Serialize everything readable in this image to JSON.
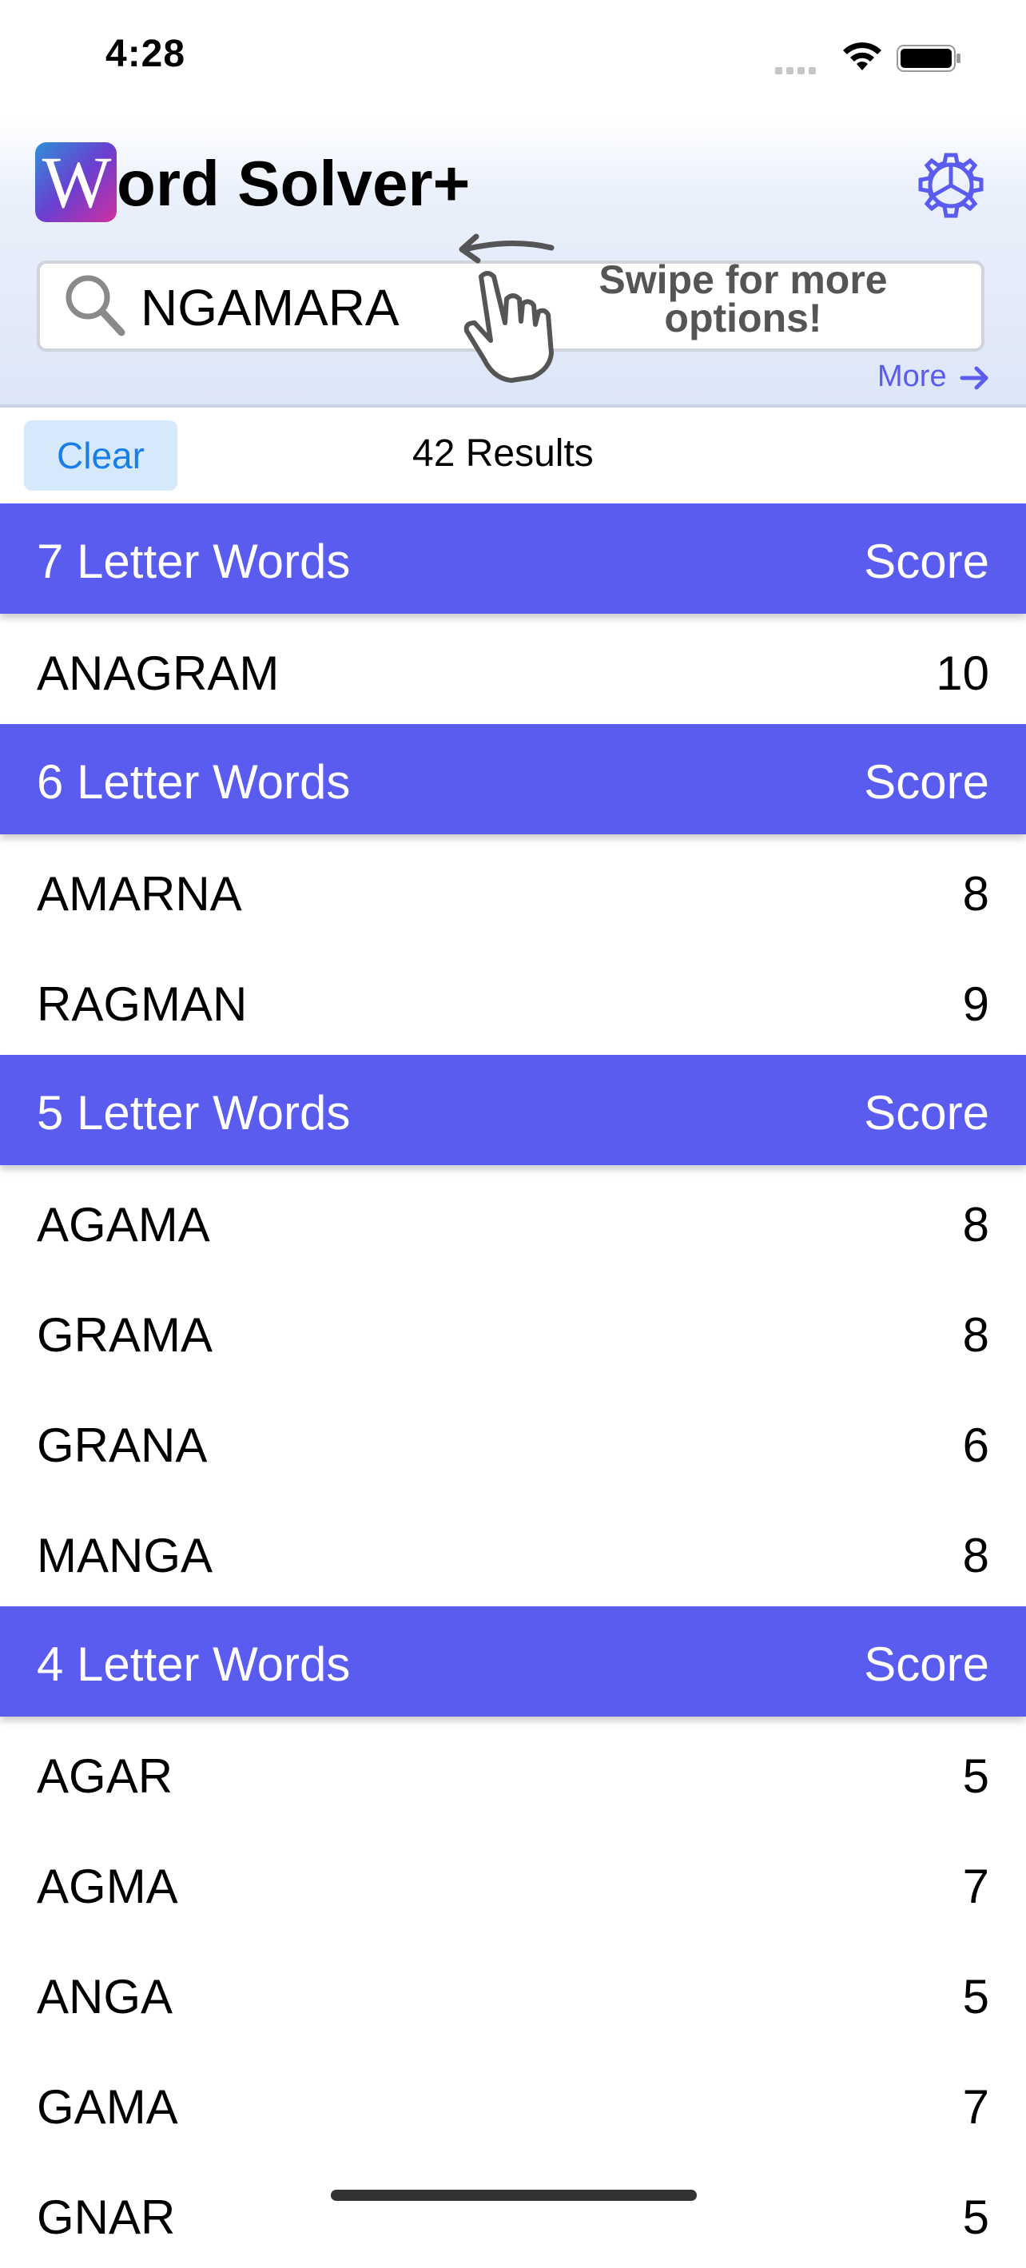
{
  "status_bar": {
    "time": "4:28"
  },
  "app": {
    "logo_letter": "W",
    "title": "ord Solver+"
  },
  "search": {
    "value": "NGAMARA",
    "hint": "Swipe for more options!"
  },
  "more_link": "More",
  "toolbar": {
    "clear_label": "Clear",
    "results": "42 Results"
  },
  "sections": [
    {
      "title": "7 Letter Words",
      "score_label": "Score",
      "rows": [
        {
          "word": "ANAGRAM",
          "score": "10"
        }
      ]
    },
    {
      "title": "6 Letter Words",
      "score_label": "Score",
      "rows": [
        {
          "word": "AMARNA",
          "score": "8"
        },
        {
          "word": "RAGMAN",
          "score": "9"
        }
      ]
    },
    {
      "title": "5 Letter Words",
      "score_label": "Score",
      "rows": [
        {
          "word": "AGAMA",
          "score": "8"
        },
        {
          "word": "GRAMA",
          "score": "8"
        },
        {
          "word": "GRANA",
          "score": "6"
        },
        {
          "word": "MANGA",
          "score": "8"
        }
      ]
    },
    {
      "title": "4 Letter Words",
      "score_label": "Score",
      "rows": [
        {
          "word": "AGAR",
          "score": "5"
        },
        {
          "word": "AGMA",
          "score": "7"
        },
        {
          "word": "ANGA",
          "score": "5"
        },
        {
          "word": "GAMA",
          "score": "7"
        },
        {
          "word": "GNAR",
          "score": "5"
        }
      ]
    }
  ],
  "colors": {
    "accent": "#5a5cf0",
    "link": "#1a7ee8",
    "clear_bg": "#d5e9fb"
  }
}
